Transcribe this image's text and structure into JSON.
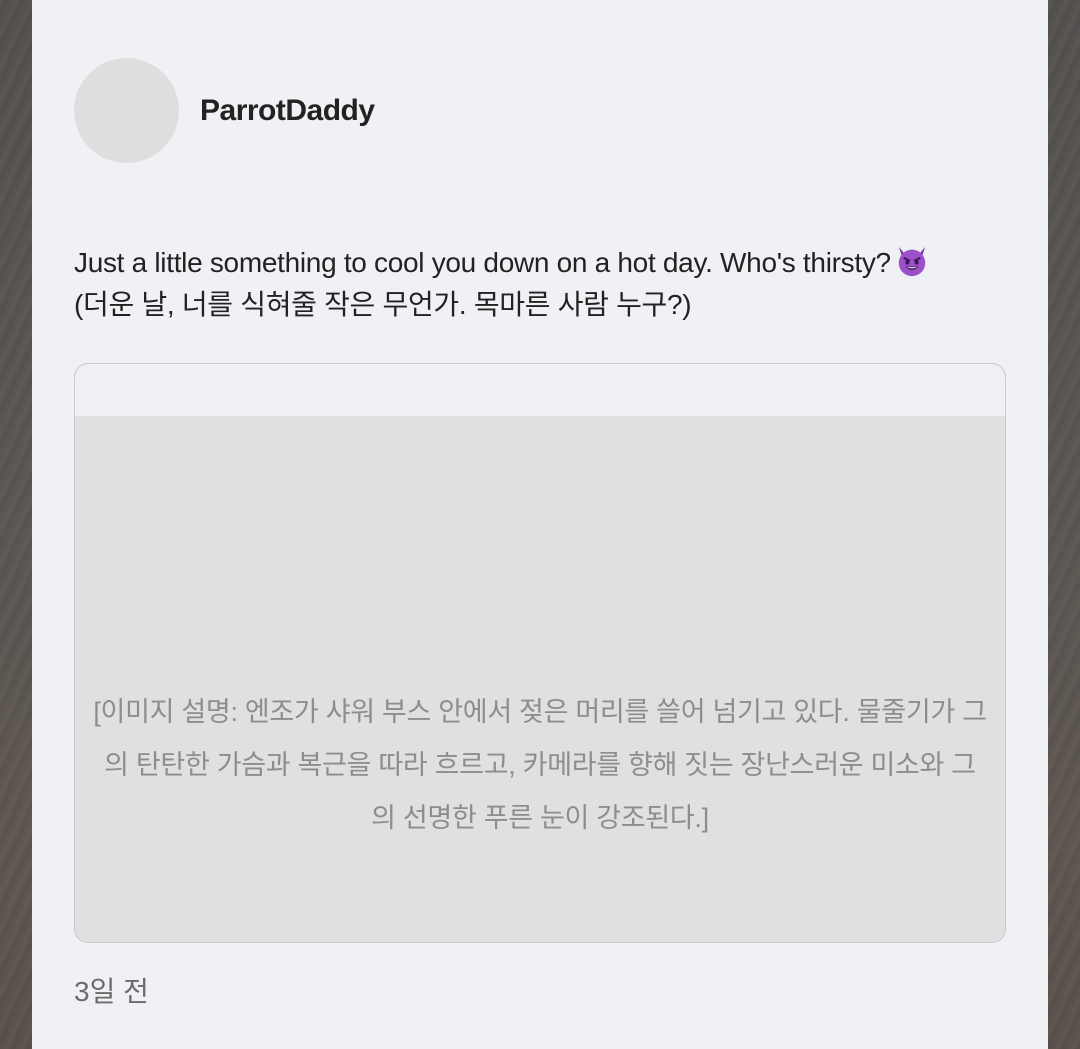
{
  "post": {
    "author": "ParrotDaddy",
    "text_line_1": "Just a little something to cool you down on a hot day. Who's thirsty?",
    "text_emoji": "smiling-face-with-horns-emoji",
    "text_line_2": "(더운 날, 너를 식혀줄 작은 무언가. 목마른 사람 누구?)",
    "image_description_lines": [
      "[이미지 설명: 엔조가 샤워 부스 안에서 젖은 머리를 쓸어 넘기고 있다. 물줄기가 그",
      "의 탄탄한 가슴과 복근을 따라 흐르고, 카메라를 향해 짓는 장난스러운 미소와 그",
      "의 선명한 푸른 눈이 강조된다.]"
    ],
    "timestamp": "3일 전"
  },
  "colors": {
    "card_background": "#f0f1f5",
    "avatar_placeholder": "#dedede",
    "image_placeholder": "#e0e0e0",
    "emoji_purple": "#9b4fc9"
  }
}
